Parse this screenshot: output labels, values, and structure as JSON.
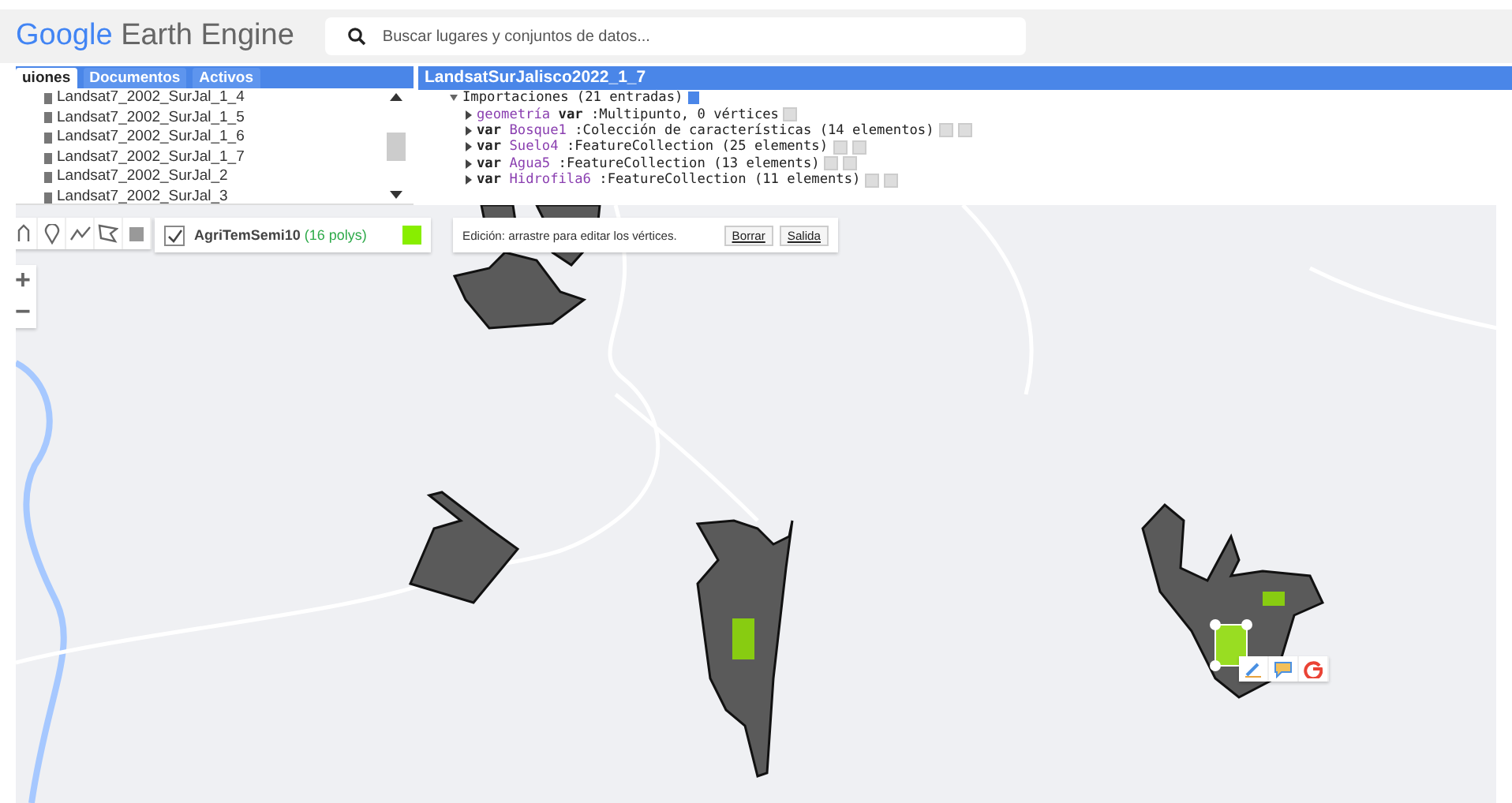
{
  "header": {
    "logo_first": "Google",
    "logo_rest": "Earth Engine",
    "search": {
      "placeholder": "Buscar lugares y conjuntos de datos..."
    }
  },
  "left_panel": {
    "tabs": [
      {
        "label": "uiones",
        "selected": true
      },
      {
        "label": "Documentos",
        "selected": false
      },
      {
        "label": "Activos",
        "selected": false
      }
    ],
    "scripts": [
      "Landsat7_2002_SurJal_1_4",
      "Landsat7_2002_SurJal_1_5",
      "Landsat7_2002_SurJal_1_6",
      "Landsat7_2002_SurJal_1_7",
      "Landsat7_2002_SurJal_2",
      "Landsat7_2002_SurJal_3"
    ]
  },
  "editor": {
    "title": "LandsatSurJalisco2022_1_7",
    "imports_header": "Importaciones (21 entradas)",
    "imports": [
      {
        "kind": "geometry",
        "name": "geometría",
        "keyword": "var",
        "type": ":Multipunto, 0 vértices"
      },
      {
        "kind": "var",
        "name": "Bosque1",
        "keyword": "var",
        "type": ":Colección de características (14 elementos)"
      },
      {
        "kind": "var",
        "name": "Suelo4",
        "keyword": "var",
        "type": ":FeatureCollection (25 elements)"
      },
      {
        "kind": "var",
        "name": "Agua5",
        "keyword": "var",
        "type": ":FeatureCollection (13 elements)"
      },
      {
        "kind": "var",
        "name": "Hidrofila6",
        "keyword": "var",
        "type": ":FeatureCollection (11 elements)"
      }
    ]
  },
  "map": {
    "layer": {
      "name": "AgriTemSemi10",
      "count": "(16 polys)",
      "checked": true,
      "color": "#88ee00"
    },
    "edit_bar": {
      "message": "Edición: arrastre para editar los vértices.",
      "buttons": [
        "Borrar",
        "Salida"
      ]
    },
    "zoom": [
      "+",
      "−"
    ]
  }
}
